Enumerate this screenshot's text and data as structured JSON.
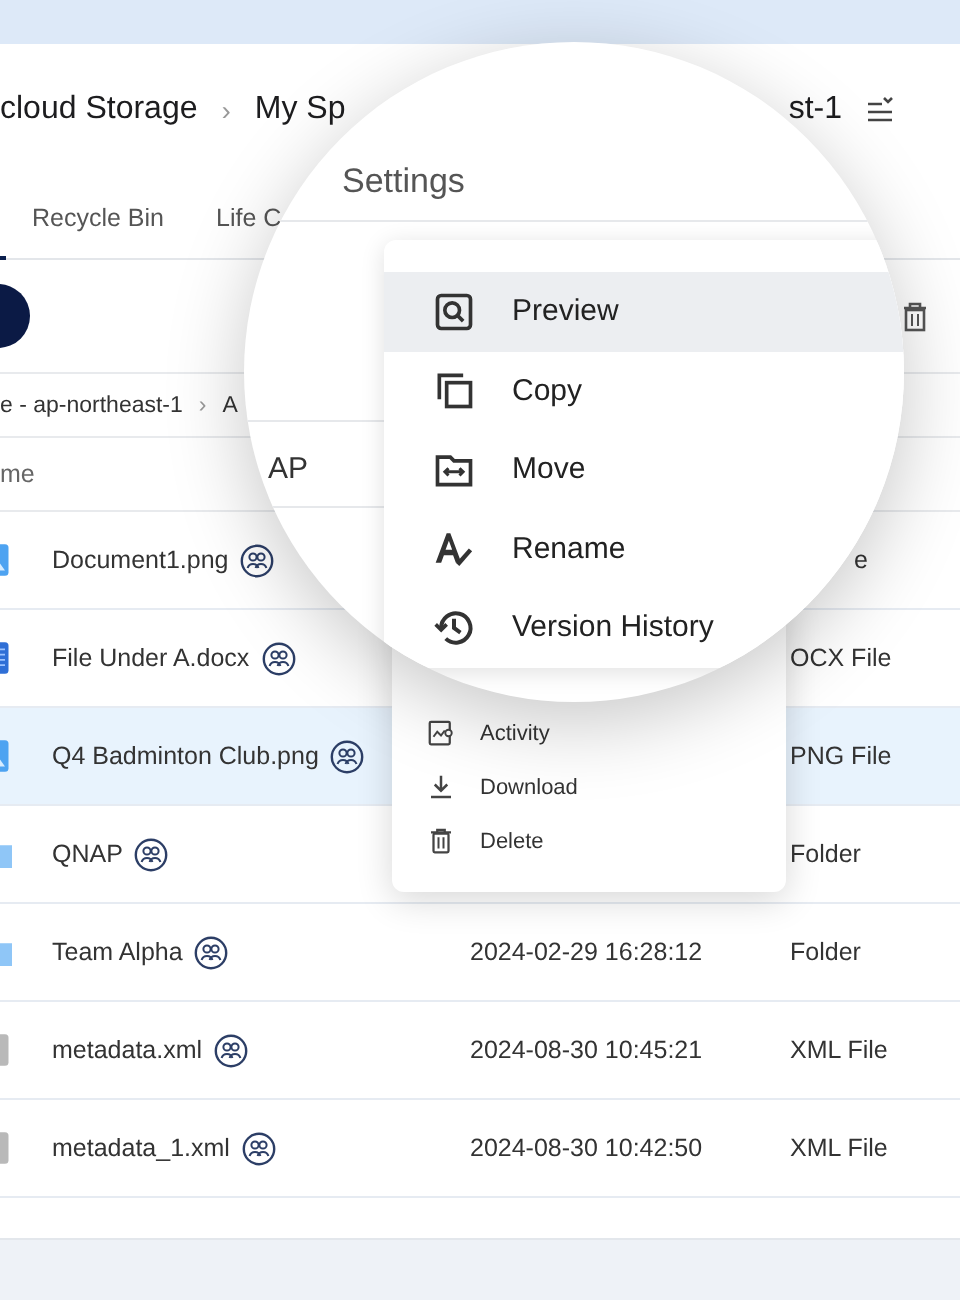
{
  "header": {
    "breadcrumb": [
      "cloud Storage",
      "My Sp"
    ],
    "separator": "›",
    "region": "st-1"
  },
  "tabs": [
    {
      "label": "Recycle Bin",
      "selected": false
    },
    {
      "label": "Life C",
      "selected": false
    }
  ],
  "path": {
    "items": [
      "e - ap-northeast-1",
      "A"
    ],
    "separator": "›"
  },
  "table": {
    "columns": [
      "me"
    ],
    "rows": [
      {
        "name": "Document1.png",
        "kind": "image",
        "shared": true,
        "modified": "",
        "type": "e",
        "selected": false
      },
      {
        "name": "File Under A.docx",
        "kind": "doc",
        "shared": true,
        "modified": "",
        "type": "OCX File",
        "selected": false
      },
      {
        "name": "Q4 Badminton Club.png",
        "kind": "image",
        "shared": true,
        "modified": "",
        "type": "PNG File",
        "selected": true
      },
      {
        "name": "QNAP",
        "kind": "folder",
        "shared": true,
        "modified": "",
        "type": "Folder",
        "selected": false
      },
      {
        "name": "Team Alpha",
        "kind": "folder",
        "shared": true,
        "modified": "2024-02-29 16:28:12",
        "type": "Folder",
        "selected": false
      },
      {
        "name": "metadata.xml",
        "kind": "file",
        "shared": true,
        "modified": "2024-08-30 10:45:21",
        "type": "XML File",
        "selected": false
      },
      {
        "name": "metadata_1.xml",
        "kind": "file",
        "shared": true,
        "modified": "2024-08-30 10:42:50",
        "type": "XML File",
        "selected": false
      }
    ]
  },
  "context_menu": [
    {
      "label": "Activity",
      "kind": "activity"
    },
    {
      "label": "Download",
      "kind": "download"
    },
    {
      "label": "Delete",
      "kind": "delete"
    }
  ],
  "lens": {
    "title": "Settings",
    "fragment": "AP",
    "menu": [
      {
        "label": "Preview",
        "kind": "preview",
        "selected": true
      },
      {
        "label": "Copy",
        "kind": "copy",
        "selected": false
      },
      {
        "label": "Move",
        "kind": "move",
        "selected": false
      },
      {
        "label": "Rename",
        "kind": "rename",
        "selected": false
      },
      {
        "label": "Version History",
        "kind": "history",
        "selected": false
      }
    ]
  }
}
